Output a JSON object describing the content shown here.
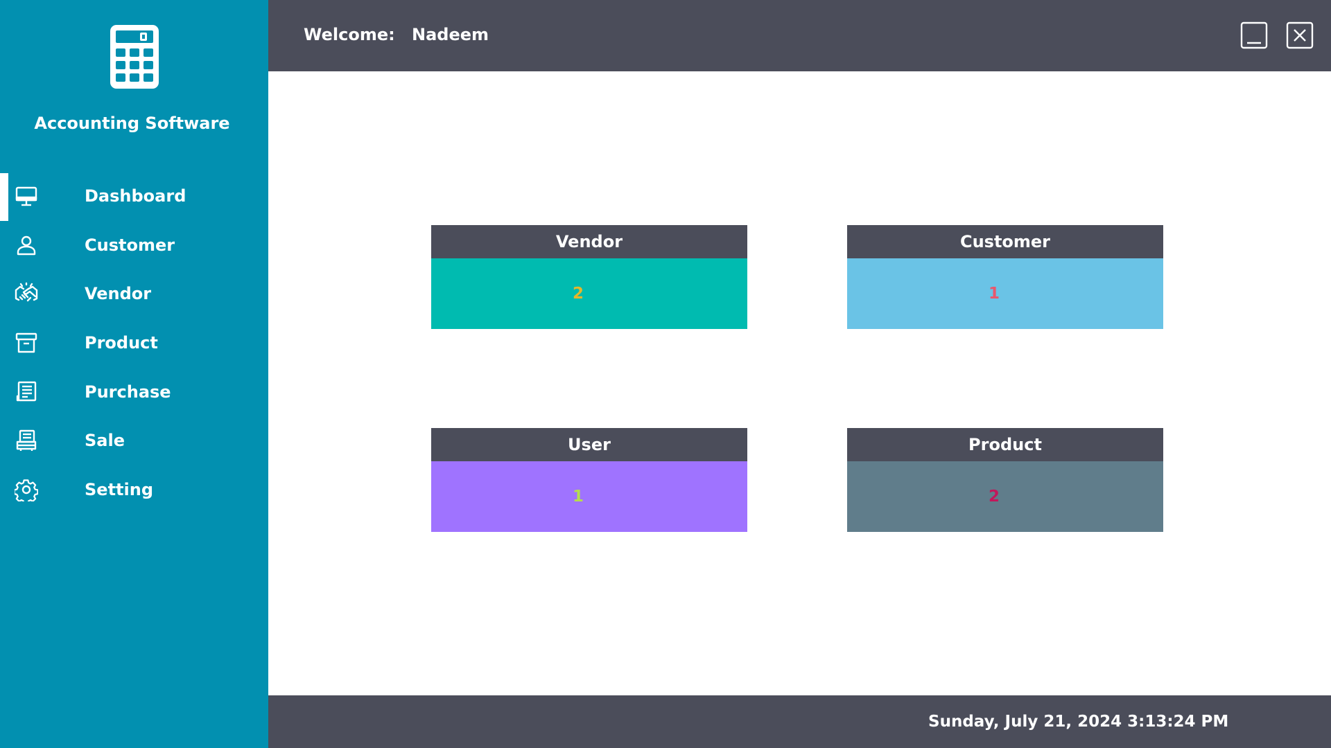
{
  "app": {
    "title": "Accounting Software",
    "logo_icon": "calculator-icon"
  },
  "sidebar": {
    "items": [
      {
        "label": "Dashboard",
        "icon": "monitor-icon",
        "active": true
      },
      {
        "label": "Customer",
        "icon": "user-icon",
        "active": false
      },
      {
        "label": "Vendor",
        "icon": "handshake-icon",
        "active": false
      },
      {
        "label": "Product",
        "icon": "archive-box-icon",
        "active": false
      },
      {
        "label": "Purchase",
        "icon": "receipt-icon",
        "active": false
      },
      {
        "label": "Sale",
        "icon": "cash-register-icon",
        "active": false
      },
      {
        "label": "Setting",
        "icon": "gear-icon",
        "active": false
      }
    ]
  },
  "header": {
    "welcome_label": "Welcome:",
    "username": "Nadeem"
  },
  "cards": [
    {
      "title": "Vendor",
      "value": "2",
      "bg_color": "#00bbb0",
      "value_color": "#e6b62a"
    },
    {
      "title": "Customer",
      "value": "1",
      "bg_color": "#6ac3e6",
      "value_color": "#e8576d"
    },
    {
      "title": "User",
      "value": "1",
      "bg_color": "#9f73ff",
      "value_color": "#b5dc4f"
    },
    {
      "title": "Product",
      "value": "2",
      "bg_color": "#607d8b",
      "value_color": "#c2185b"
    }
  ],
  "footer": {
    "datetime": "Sunday, July 21, 2024 3:13:24 PM"
  },
  "colors": {
    "sidebar": "#0290b0",
    "bars": "#4b4d5a",
    "content": "#ffffff"
  }
}
